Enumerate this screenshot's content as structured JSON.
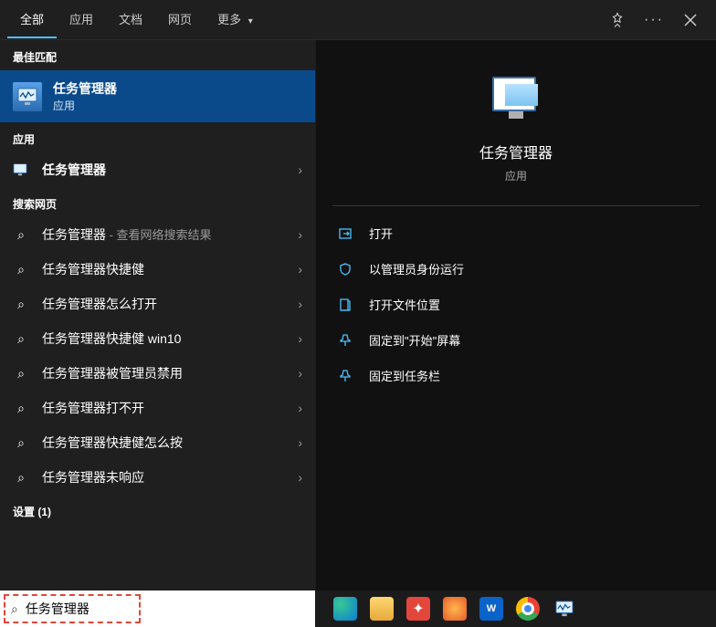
{
  "tabs": {
    "all": "全部",
    "apps": "应用",
    "docs": "文档",
    "web": "网页",
    "more": "更多"
  },
  "sections": {
    "best_match": "最佳匹配",
    "apps": "应用",
    "search_web": "搜索网页",
    "settings": "设置 (1)"
  },
  "best": {
    "title": "任务管理器",
    "subtitle": "应用"
  },
  "app_result": {
    "label": "任务管理器"
  },
  "web_results": [
    {
      "label": "任务管理器",
      "suffix": " - 查看网络搜索结果"
    },
    {
      "label": "任务管理器快捷健",
      "suffix": ""
    },
    {
      "label": "任务管理器怎么打开",
      "suffix": ""
    },
    {
      "label": "任务管理器快捷健 win10",
      "suffix": ""
    },
    {
      "label": "任务管理器被管理员禁用",
      "suffix": ""
    },
    {
      "label": "任务管理器打不开",
      "suffix": ""
    },
    {
      "label": "任务管理器快捷健怎么按",
      "suffix": ""
    },
    {
      "label": "任务管理器未响应",
      "suffix": ""
    }
  ],
  "preview": {
    "title": "任务管理器",
    "subtitle": "应用",
    "actions": {
      "open": "打开",
      "run_admin": "以管理员身份运行",
      "open_location": "打开文件位置",
      "pin_start": "固定到\"开始\"屏幕",
      "pin_taskbar": "固定到任务栏"
    }
  },
  "search": {
    "value": "任务管理器"
  }
}
